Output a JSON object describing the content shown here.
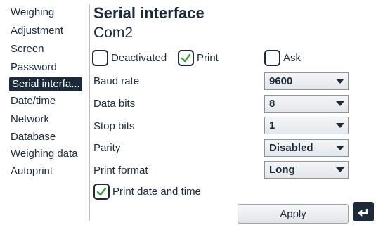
{
  "sidebar": {
    "items": [
      {
        "label": "Weighing"
      },
      {
        "label": "Adjustment"
      },
      {
        "label": "Screen"
      },
      {
        "label": "Password"
      },
      {
        "label": "Serial interfa..."
      },
      {
        "label": "Date/time"
      },
      {
        "label": "Network"
      },
      {
        "label": "Database"
      },
      {
        "label": "Weighing data"
      },
      {
        "label": "Autoprint"
      }
    ],
    "active_index": 4
  },
  "main": {
    "title": "Serial interface",
    "subtitle": "Com2",
    "mode": {
      "deactivated": {
        "label": "Deactivated",
        "checked": false
      },
      "print": {
        "label": "Print",
        "checked": true
      },
      "ask": {
        "label": "Ask",
        "checked": false
      }
    },
    "settings": [
      {
        "label": "Baud rate",
        "value": "9600"
      },
      {
        "label": "Data bits",
        "value": "8"
      },
      {
        "label": "Stop bits",
        "value": "1"
      },
      {
        "label": "Parity",
        "value": "Disabled"
      },
      {
        "label": "Print format",
        "value": "Long"
      }
    ],
    "print_date_time": {
      "label": "Print date and time",
      "checked": true
    },
    "apply_label": "Apply",
    "back_icon": "return-arrow-icon"
  },
  "colors": {
    "accent": "#1c2a3a",
    "check": "#3a9a3a"
  }
}
